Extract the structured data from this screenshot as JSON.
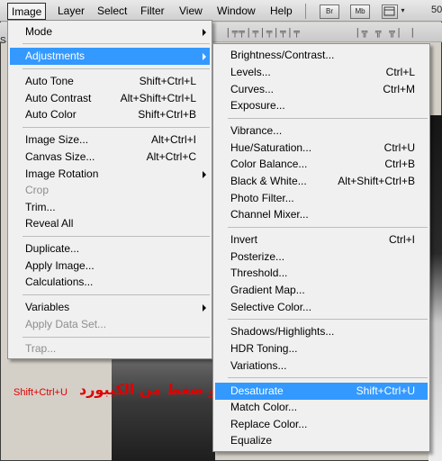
{
  "menubar": {
    "items": [
      "Image",
      "Layer",
      "Select",
      "Filter",
      "View",
      "Window",
      "Help"
    ],
    "icons": [
      {
        "name": "bridge-icon",
        "label": "Br"
      },
      {
        "name": "mini-bridge-icon",
        "label": "Mb"
      },
      {
        "name": "view-extras-icon",
        "label": ""
      }
    ],
    "zoom_partial": "50"
  },
  "options_glyphs_left": "|╤╤|╤|╤|╤|╤",
  "options_glyphs_right": "|╦ ╦ ╦| |",
  "left_edge_label": "S",
  "image_menu": {
    "items": [
      {
        "label": "Mode",
        "shortcut": "",
        "submenu": true,
        "disabled": false,
        "highlight": false
      },
      {
        "label": "Adjustments",
        "shortcut": "",
        "submenu": true,
        "disabled": false,
        "highlight": true
      },
      {
        "label": "Auto Tone",
        "shortcut": "Shift+Ctrl+L",
        "submenu": false,
        "disabled": false,
        "highlight": false
      },
      {
        "label": "Auto Contrast",
        "shortcut": "Alt+Shift+Ctrl+L",
        "submenu": false,
        "disabled": false,
        "highlight": false
      },
      {
        "label": "Auto Color",
        "shortcut": "Shift+Ctrl+B",
        "submenu": false,
        "disabled": false,
        "highlight": false
      },
      {
        "label": "Image Size...",
        "shortcut": "Alt+Ctrl+I",
        "submenu": false,
        "disabled": false,
        "highlight": false
      },
      {
        "label": "Canvas Size...",
        "shortcut": "Alt+Ctrl+C",
        "submenu": false,
        "disabled": false,
        "highlight": false
      },
      {
        "label": "Image Rotation",
        "shortcut": "",
        "submenu": true,
        "disabled": false,
        "highlight": false
      },
      {
        "label": "Crop",
        "shortcut": "",
        "submenu": false,
        "disabled": true,
        "highlight": false
      },
      {
        "label": "Trim...",
        "shortcut": "",
        "submenu": false,
        "disabled": false,
        "highlight": false
      },
      {
        "label": "Reveal All",
        "shortcut": "",
        "submenu": false,
        "disabled": false,
        "highlight": false
      },
      {
        "label": "Duplicate...",
        "shortcut": "",
        "submenu": false,
        "disabled": false,
        "highlight": false
      },
      {
        "label": "Apply Image...",
        "shortcut": "",
        "submenu": false,
        "disabled": false,
        "highlight": false
      },
      {
        "label": "Calculations...",
        "shortcut": "",
        "submenu": false,
        "disabled": false,
        "highlight": false
      },
      {
        "label": "Variables",
        "shortcut": "",
        "submenu": true,
        "disabled": false,
        "highlight": false
      },
      {
        "label": "Apply Data Set...",
        "shortcut": "",
        "submenu": false,
        "disabled": true,
        "highlight": false
      },
      {
        "label": "Trap...",
        "shortcut": "",
        "submenu": false,
        "disabled": true,
        "highlight": false
      }
    ]
  },
  "adjustments_menu": {
    "items": [
      {
        "label": "Brightness/Contrast...",
        "shortcut": "",
        "highlight": false
      },
      {
        "label": "Levels...",
        "shortcut": "Ctrl+L",
        "highlight": false
      },
      {
        "label": "Curves...",
        "shortcut": "Ctrl+M",
        "highlight": false
      },
      {
        "label": "Exposure...",
        "shortcut": "",
        "highlight": false
      },
      {
        "label": "Vibrance...",
        "shortcut": "",
        "highlight": false
      },
      {
        "label": "Hue/Saturation...",
        "shortcut": "Ctrl+U",
        "highlight": false
      },
      {
        "label": "Color Balance...",
        "shortcut": "Ctrl+B",
        "highlight": false
      },
      {
        "label": "Black & White...",
        "shortcut": "Alt+Shift+Ctrl+B",
        "highlight": false
      },
      {
        "label": "Photo Filter...",
        "shortcut": "",
        "highlight": false
      },
      {
        "label": "Channel Mixer...",
        "shortcut": "",
        "highlight": false
      },
      {
        "label": "Invert",
        "shortcut": "Ctrl+I",
        "highlight": false
      },
      {
        "label": "Posterize...",
        "shortcut": "",
        "highlight": false
      },
      {
        "label": "Threshold...",
        "shortcut": "",
        "highlight": false
      },
      {
        "label": "Gradient Map...",
        "shortcut": "",
        "highlight": false
      },
      {
        "label": "Selective Color...",
        "shortcut": "",
        "highlight": false
      },
      {
        "label": "Shadows/Highlights...",
        "shortcut": "",
        "highlight": false
      },
      {
        "label": "HDR Toning...",
        "shortcut": "",
        "highlight": false
      },
      {
        "label": "Variations...",
        "shortcut": "",
        "highlight": false
      },
      {
        "label": "Desaturate",
        "shortcut": "Shift+Ctrl+U",
        "highlight": true
      },
      {
        "label": "Match Color...",
        "shortcut": "",
        "highlight": false
      },
      {
        "label": "Replace Color...",
        "shortcut": "",
        "highlight": false
      },
      {
        "label": "Equalize",
        "shortcut": "",
        "highlight": false
      }
    ]
  },
  "annotation": {
    "shortcut_text": "Shift+Ctrl+U",
    "arabic_text": "او ضغط من الكيبورد"
  },
  "colors": {
    "highlight": "#3399ff",
    "annotation": "#e00000",
    "menu_bg": "#f0f0f0"
  }
}
